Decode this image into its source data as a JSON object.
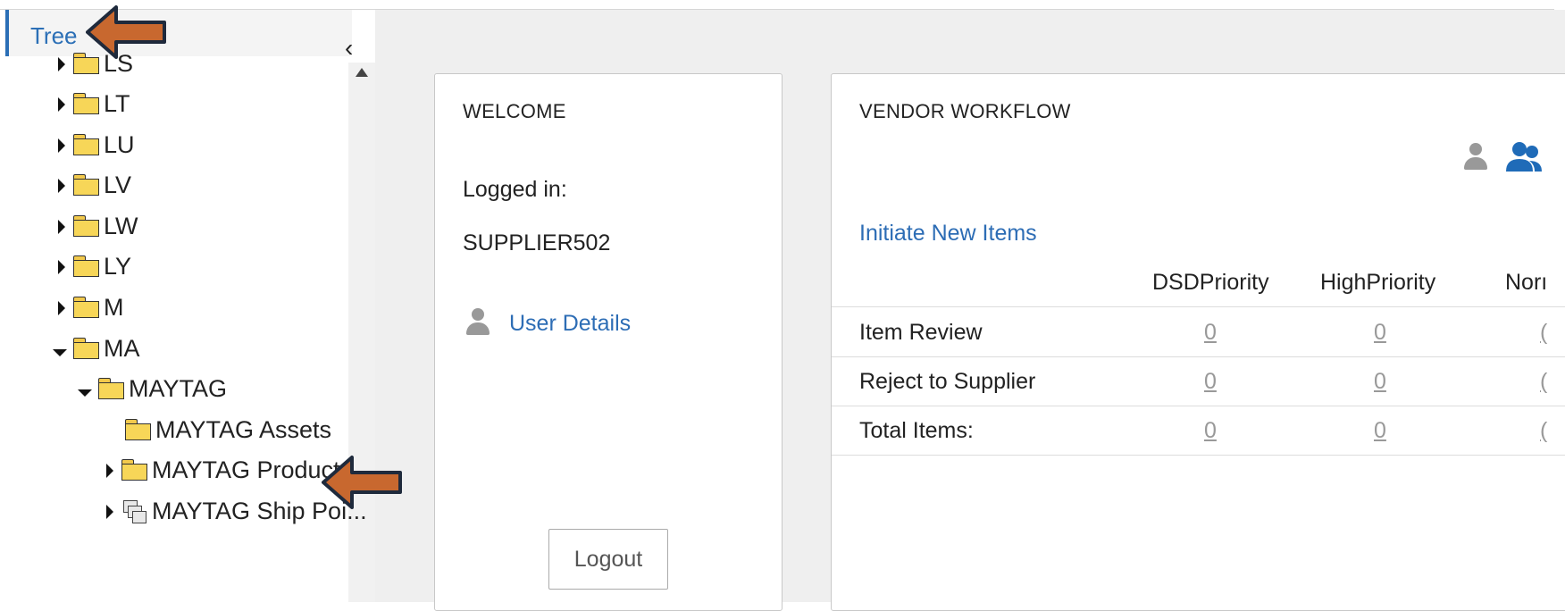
{
  "tree": {
    "tab_label": "Tree",
    "collapse_glyph": "‹",
    "items": [
      {
        "label": "LS"
      },
      {
        "label": "LT"
      },
      {
        "label": "LU"
      },
      {
        "label": "LV"
      },
      {
        "label": "LW"
      },
      {
        "label": "LY"
      },
      {
        "label": "M"
      },
      {
        "label": "MA"
      },
      {
        "label": "MAYTAG"
      },
      {
        "label": "MAYTAG Assets"
      },
      {
        "label": "MAYTAG Products"
      },
      {
        "label": "MAYTAG Ship Poi..."
      }
    ]
  },
  "welcome": {
    "title": "WELCOME",
    "logged_in_label": "Logged in:",
    "username": "SUPPLIER502",
    "user_details_link": "User Details",
    "logout_label": "Logout"
  },
  "workflow": {
    "title": "VENDOR WORKFLOW",
    "initiate_link": "Initiate New Items",
    "columns": [
      "DSDPriority",
      "HighPriority",
      "Norı"
    ],
    "rows": [
      {
        "label": "Item Review",
        "values": [
          "0",
          "0",
          "("
        ]
      },
      {
        "label": "Reject to Supplier",
        "values": [
          "0",
          "0",
          "("
        ]
      },
      {
        "label": "Total Items:",
        "values": [
          "0",
          "0",
          "("
        ]
      }
    ]
  },
  "colors": {
    "accent": "#2b6fb6",
    "link": "#2d6db5",
    "arrow_fill": "#c8682f",
    "arrow_border": "#1f2a3c",
    "folder": "#f7d658"
  },
  "icons": {
    "user": "person-icon",
    "group": "group-icon",
    "folder": "folder-icon",
    "ship_points": "ship-points-icon"
  }
}
